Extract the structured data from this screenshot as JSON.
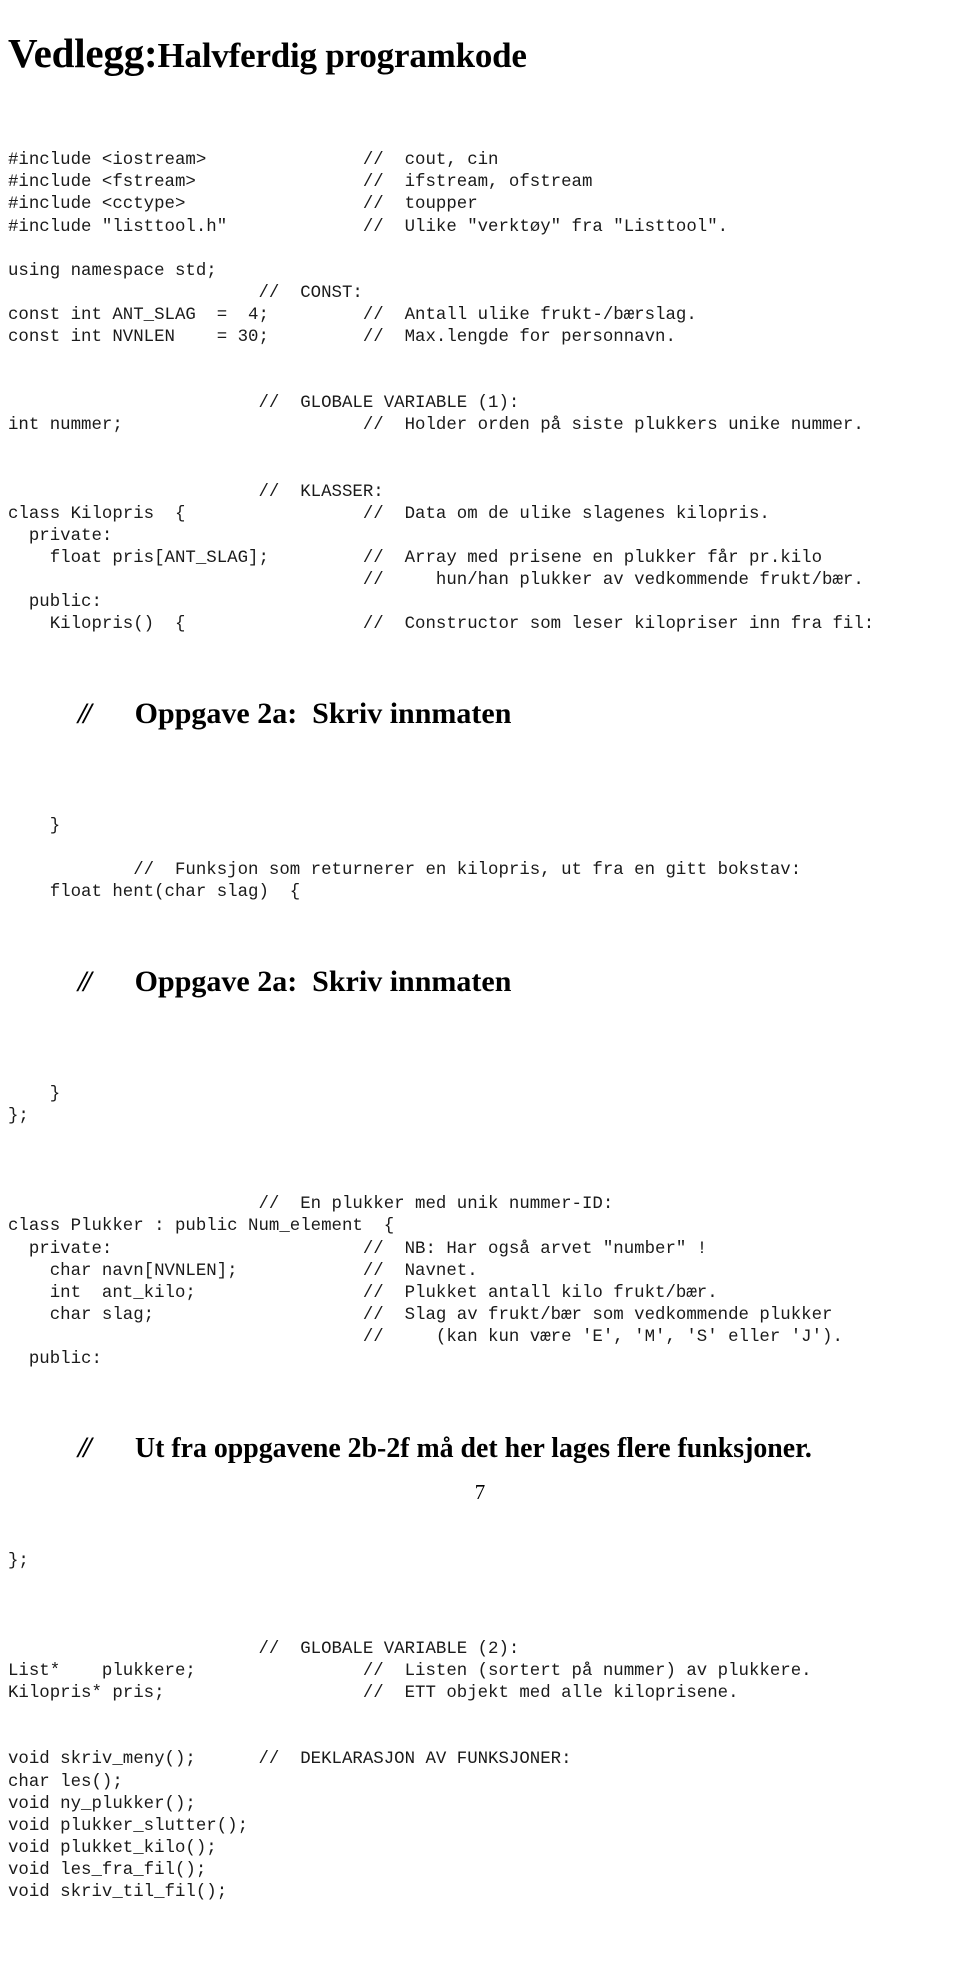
{
  "document": {
    "title_lead": "Vedlegg:",
    "title_rest": "Halvferdig programkode",
    "page_number": "7"
  },
  "code": {
    "lines": [
      "#include <iostream>               //  cout, cin",
      "#include <fstream>                //  ifstream, ofstream",
      "#include <cctype>                 //  toupper",
      "#include \"listtool.h\"             //  Ulike \"verktøy\" fra \"Listtool\".",
      "",
      "using namespace std;",
      "                        //  CONST:",
      "const int ANT_SLAG  =  4;         //  Antall ulike frukt-/bærslag.",
      "const int NVNLEN    = 30;         //  Max.lengde for personnavn.",
      "",
      "",
      "                        //  GLOBALE VARIABLE (1):",
      "int nummer;                       //  Holder orden på siste plukkers unike nummer.",
      "",
      "",
      "                        //  KLASSER:",
      "class Kilopris  {                 //  Data om de ulike slagenes kilopris.",
      "  private:",
      "    float pris[ANT_SLAG];         //  Array med prisene en plukker får pr.kilo",
      "                                  //     hun/han plukker av vedkommende frukt/bær.",
      "  public:",
      "    Kilopris()  {                 //  Constructor som leser kilopriser inn fra fil:"
    ],
    "lines2": [
      "    }",
      "",
      "            //  Funksjon som returnerer en kilopris, ut fra en gitt bokstav:",
      "    float hent(char slag)  {"
    ],
    "lines3": [
      "    }",
      "};",
      "",
      "",
      "",
      "                        //  En plukker med unik nummer-ID:",
      "class Plukker : public Num_element  {",
      "  private:                        //  NB: Har også arvet \"number\" !",
      "    char navn[NVNLEN];            //  Navnet.",
      "    int  ant_kilo;                //  Plukket antall kilo frukt/bær.",
      "    char slag;                    //  Slag av frukt/bær som vedkommende plukker",
      "                                  //     (kan kun være 'E', 'M', 'S' eller 'J').",
      "  public:"
    ],
    "lines4": [
      "};",
      "",
      "",
      "",
      "                        //  GLOBALE VARIABLE (2):",
      "List*    plukkere;                //  Listen (sortert på nummer) av plukkere.",
      "Kilopris* pris;                   //  ETT objekt med alle kiloprisene.",
      "",
      "",
      "void skriv_meny();      //  DEKLARASJON AV FUNKSJONER:",
      "char les();",
      "void ny_plukker();",
      "void plukker_slutter();",
      "void plukket_kilo();",
      "void les_fra_fil();",
      "void skriv_til_fil();"
    ]
  },
  "tasks": {
    "task_a1_slashes": "//",
    "task_a1_text": "Oppgave 2a:  Skriv innmaten",
    "task_a2_slashes": "//",
    "task_a2_text": "Oppgave 2a:  Skriv innmaten",
    "task_b_slashes": "//",
    "task_b_text": "Ut fra oppgavene 2b-2f må det her lages flere funksjoner."
  }
}
